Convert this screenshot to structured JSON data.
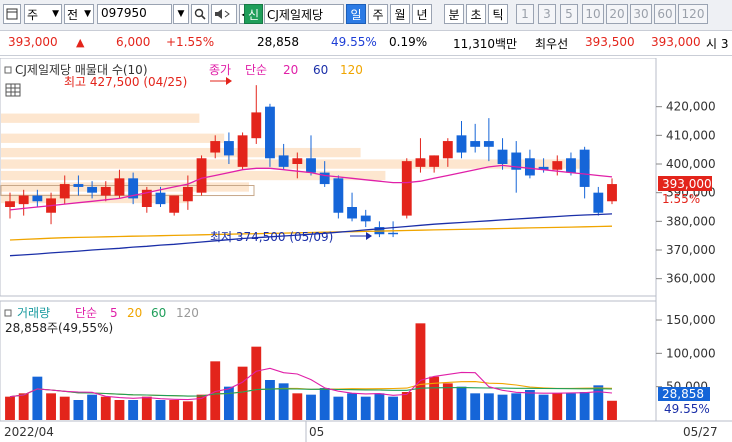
{
  "toolbar": {
    "period_select": "주",
    "prev_label": "전",
    "code": "097950",
    "new_badge": "신",
    "stock_name": "CJ제일제당",
    "period_tabs": [
      "일",
      "주",
      "월",
      "년",
      "분",
      "초",
      "틱"
    ],
    "active_tab": "일",
    "minute_options": [
      "1",
      "3",
      "5",
      "10",
      "20",
      "30",
      "60",
      "120"
    ]
  },
  "quote": {
    "price": "393,000",
    "direction": "▲",
    "change": "6,000",
    "change_pct": "+1.55%",
    "volume": "28,858",
    "volume_ratio": "49.55%",
    "turnover_rate": "0.19%",
    "trade_value": "11,310백만",
    "priority_label": "최우선",
    "ask": "393,500",
    "bid": "393,000",
    "cut": "시 3"
  },
  "price_panel": {
    "legend_name": "CJ제일제당 매물대 수(10)",
    "legend_close": "종가",
    "legend_ma_type": "단순",
    "ma_periods": [
      "20",
      "60",
      "120"
    ],
    "high_label": "최고 427,500 (04/25)",
    "low_label": "최저 374,500 (05/09)",
    "current_price_tag": "393,000",
    "current_pct_tag": "1.55%",
    "y_ticks": [
      "420,000",
      "410,000",
      "400,000",
      "390,000",
      "380,000",
      "370,000",
      "360,000"
    ]
  },
  "volume_panel": {
    "legend_name": "거래량",
    "legend_ma_type": "단순",
    "ma_periods": [
      "5",
      "20",
      "60",
      "120"
    ],
    "current_value": "28,858주(49,55%)",
    "y_ticks": [
      "150,000",
      "100,000",
      "50,000"
    ],
    "current_tag": "28,858",
    "current_pct_tag": "49.55%"
  },
  "x_axis": {
    "left_label": "2022/04",
    "mid_label": "05",
    "right_label": "05/27"
  },
  "colors": {
    "up": "#e3241b",
    "down": "#1565d8",
    "ma20": "#e020a8",
    "ma60": "#1b2fa8",
    "ma120": "#f0a500",
    "volume_profile": "#fde6cf"
  },
  "chart_data": [
    {
      "type": "candlestick",
      "title": "CJ제일제당",
      "ylim": [
        355000,
        430000
      ],
      "candles": [
        {
          "o": 385000,
          "h": 390000,
          "l": 381000,
          "c": 387000
        },
        {
          "o": 386000,
          "h": 391000,
          "l": 382000,
          "c": 389000
        },
        {
          "o": 389000,
          "h": 391000,
          "l": 385000,
          "c": 387000
        },
        {
          "o": 383000,
          "h": 390000,
          "l": 379000,
          "c": 388000
        },
        {
          "o": 388000,
          "h": 396000,
          "l": 386000,
          "c": 393000
        },
        {
          "o": 393000,
          "h": 396000,
          "l": 389000,
          "c": 392000
        },
        {
          "o": 392000,
          "h": 394000,
          "l": 388000,
          "c": 390000
        },
        {
          "o": 389000,
          "h": 394000,
          "l": 387000,
          "c": 392000
        },
        {
          "o": 389000,
          "h": 398000,
          "l": 388000,
          "c": 395000
        },
        {
          "o": 395000,
          "h": 397000,
          "l": 386000,
          "c": 388000
        },
        {
          "o": 385000,
          "h": 392000,
          "l": 383000,
          "c": 391000
        },
        {
          "o": 390000,
          "h": 392000,
          "l": 385000,
          "c": 386000
        },
        {
          "o": 383000,
          "h": 389000,
          "l": 382000,
          "c": 389000
        },
        {
          "o": 387000,
          "h": 396000,
          "l": 384000,
          "c": 392000
        },
        {
          "o": 390000,
          "h": 403000,
          "l": 389000,
          "c": 402000
        },
        {
          "o": 404000,
          "h": 410000,
          "l": 402000,
          "c": 408000
        },
        {
          "o": 408000,
          "h": 411000,
          "l": 400000,
          "c": 403000
        },
        {
          "o": 399000,
          "h": 411000,
          "l": 398000,
          "c": 410000
        },
        {
          "o": 409000,
          "h": 427500,
          "l": 407000,
          "c": 418000
        },
        {
          "o": 420000,
          "h": 421000,
          "l": 399000,
          "c": 402000
        },
        {
          "o": 403000,
          "h": 407000,
          "l": 398000,
          "c": 399000
        },
        {
          "o": 400000,
          "h": 404000,
          "l": 395000,
          "c": 402000
        },
        {
          "o": 402000,
          "h": 410000,
          "l": 396000,
          "c": 397000
        },
        {
          "o": 397000,
          "h": 401000,
          "l": 392000,
          "c": 393000
        },
        {
          "o": 395000,
          "h": 396000,
          "l": 381000,
          "c": 383000
        },
        {
          "o": 385000,
          "h": 390000,
          "l": 380000,
          "c": 381000
        },
        {
          "o": 382000,
          "h": 384000,
          "l": 378000,
          "c": 380000
        },
        {
          "o": 378000,
          "h": 380000,
          "l": 374500,
          "c": 375500
        },
        {
          "o": 376000,
          "h": 380000,
          "l": 374500,
          "c": 375500
        },
        {
          "o": 382000,
          "h": 402000,
          "l": 381000,
          "c": 401000
        },
        {
          "o": 399000,
          "h": 409000,
          "l": 397000,
          "c": 402000
        },
        {
          "o": 399000,
          "h": 403000,
          "l": 397000,
          "c": 403000
        },
        {
          "o": 402000,
          "h": 409000,
          "l": 399000,
          "c": 408000
        },
        {
          "o": 410000,
          "h": 415000,
          "l": 402000,
          "c": 404000
        },
        {
          "o": 408000,
          "h": 414000,
          "l": 404000,
          "c": 406000
        },
        {
          "o": 408000,
          "h": 416000,
          "l": 401000,
          "c": 406000
        },
        {
          "o": 405000,
          "h": 409000,
          "l": 398000,
          "c": 400000
        },
        {
          "o": 404000,
          "h": 408000,
          "l": 390000,
          "c": 398000
        },
        {
          "o": 402000,
          "h": 405000,
          "l": 395000,
          "c": 396000
        },
        {
          "o": 399000,
          "h": 402000,
          "l": 397000,
          "c": 398000
        },
        {
          "o": 398000,
          "h": 403000,
          "l": 396000,
          "c": 401000
        },
        {
          "o": 402000,
          "h": 404000,
          "l": 396000,
          "c": 397000
        },
        {
          "o": 405000,
          "h": 406000,
          "l": 388000,
          "c": 392000
        },
        {
          "o": 390000,
          "h": 392000,
          "l": 382000,
          "c": 383000
        },
        {
          "o": 387000,
          "h": 395000,
          "l": 386000,
          "c": 393000
        }
      ],
      "ma20": [
        384000,
        384500,
        385000,
        385500,
        386000,
        386500,
        387000,
        387500,
        388000,
        389000,
        390000,
        391000,
        392000,
        393000,
        395000,
        396000,
        397000,
        398000,
        398500,
        398500,
        398000,
        397500,
        397000,
        396000,
        395500,
        395000,
        394500,
        394000,
        393500,
        393500,
        394000,
        395000,
        396000,
        397000,
        398000,
        399000,
        399500,
        399000,
        398500,
        398000,
        397500,
        397000,
        396500,
        396000,
        395500
      ],
      "ma60": [
        368000,
        368300,
        368600,
        369000,
        369300,
        369600,
        370000,
        370300,
        370600,
        371000,
        371300,
        371700,
        372000,
        372400,
        372800,
        373200,
        373600,
        374000,
        374300,
        374600,
        374900,
        375200,
        375500,
        375800,
        376200,
        376600,
        377000,
        377400,
        377800,
        378200,
        378600,
        379000,
        379300,
        379600,
        379900,
        380200,
        380500,
        380800,
        381100,
        381400,
        381700,
        382000,
        382200,
        382400,
        382600
      ],
      "ma120": [
        373500,
        373700,
        373900,
        374100,
        374300,
        374400,
        374500,
        374600,
        374700,
        374800,
        374900,
        375000,
        375100,
        375200,
        375300,
        375400,
        375500,
        375600,
        375700,
        375800,
        375900,
        376000,
        376100,
        376200,
        376300,
        376400,
        376500,
        376600,
        376700,
        376800,
        376900,
        377000,
        377100,
        377200,
        377300,
        377400,
        377500,
        377600,
        377700,
        377800,
        377900,
        378000,
        378100,
        378200,
        378300
      ]
    },
    {
      "type": "bar",
      "title": "거래량",
      "ylim": [
        0,
        165000
      ],
      "values": [
        35000,
        40000,
        65000,
        40000,
        35000,
        30000,
        38000,
        35000,
        30000,
        30000,
        35000,
        30000,
        30000,
        28000,
        38000,
        88000,
        50000,
        80000,
        110000,
        60000,
        55000,
        40000,
        38000,
        48000,
        35000,
        40000,
        35000,
        40000,
        35000,
        42000,
        145000,
        65000,
        55000,
        50000,
        40000,
        40000,
        38000,
        40000,
        45000,
        38000,
        40000,
        40000,
        42000,
        52000,
        28858
      ]
    }
  ]
}
